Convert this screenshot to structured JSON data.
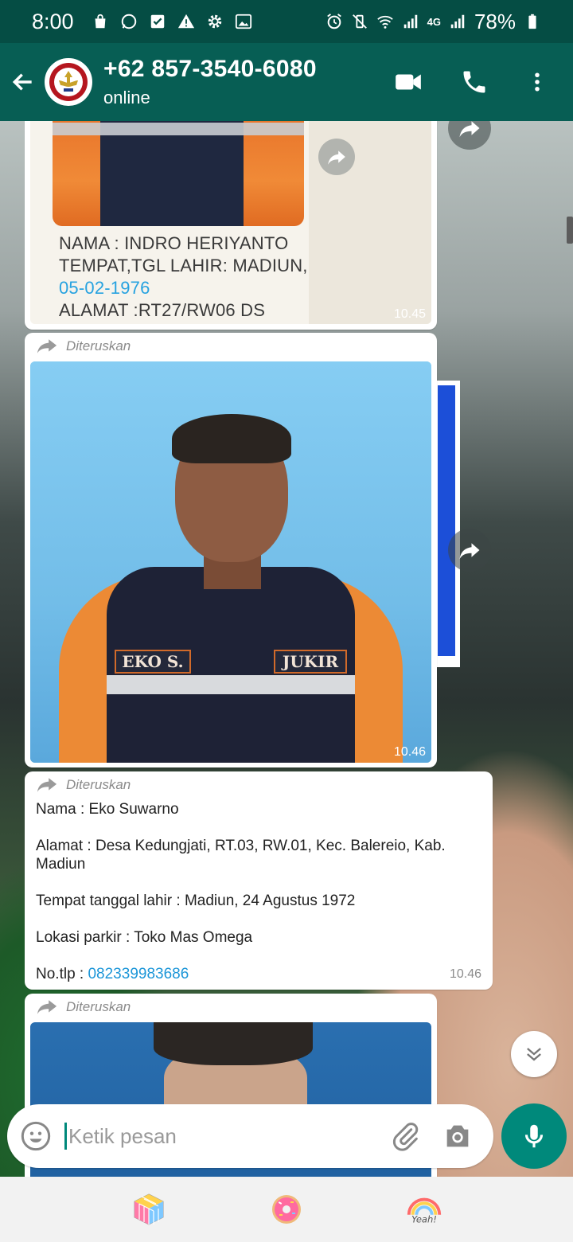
{
  "status_bar": {
    "time": "8:00",
    "network": "4G",
    "battery": "78%",
    "left_icons": [
      "shopping-bag-icon",
      "whatsapp-icon",
      "checkbox-icon",
      "warning-icon",
      "settings-icon",
      "image-icon"
    ],
    "right_icons": [
      "alarm-icon",
      "vibrate-mute-icon",
      "wifi-icon",
      "signal-icon",
      "signal-icon",
      "battery-icon"
    ]
  },
  "header": {
    "contact_name": "+62 857-3540-6080",
    "status": "online",
    "actions": [
      "video-call-icon",
      "voice-call-icon",
      "more-options-icon"
    ]
  },
  "messages": [
    {
      "type": "image",
      "text_lines": [
        "NAMA : INDRO HERIYANTO",
        "TEMPAT,TGL LAHIR: MADIUN,",
        "05-02-1976",
        "ALAMAT :RT27/RW06 DS"
      ],
      "time": "10.45"
    },
    {
      "type": "image",
      "forwarded_label": "Diteruskan",
      "vest_tags": [
        "EKO S.",
        "JUKIR"
      ],
      "time": "10.46"
    },
    {
      "type": "text",
      "forwarded_label": "Diteruskan",
      "lines": {
        "nama": "Nama  : Eko Suwarno",
        "alamat": "Alamat : Desa Kedungjati, RT.03, RW.01, Kec. Balereio, Kab. Madiun",
        "ttl": "Tempat tanggal lahir : Madiun, 24 Agustus 1972",
        "lokasi": "Lokasi parkir : Toko Mas Omega",
        "tlp_label": "No.tlp : ",
        "tlp_number": "082339983686"
      },
      "time": "10.46"
    },
    {
      "type": "image",
      "forwarded_label": "Diteruskan"
    }
  ],
  "composer": {
    "placeholder": "Ketik pesan"
  },
  "keyboard_strip": [
    "rubiks-cube-sticker-icon",
    "donut-sticker-icon",
    "yeah-rainbow-sticker-icon"
  ],
  "keyboard_sticker_text": "Yeah!",
  "colors": {
    "header": "#075e54",
    "status_bar": "#054d44",
    "accent": "#00897b",
    "link": "#1c96d8"
  }
}
